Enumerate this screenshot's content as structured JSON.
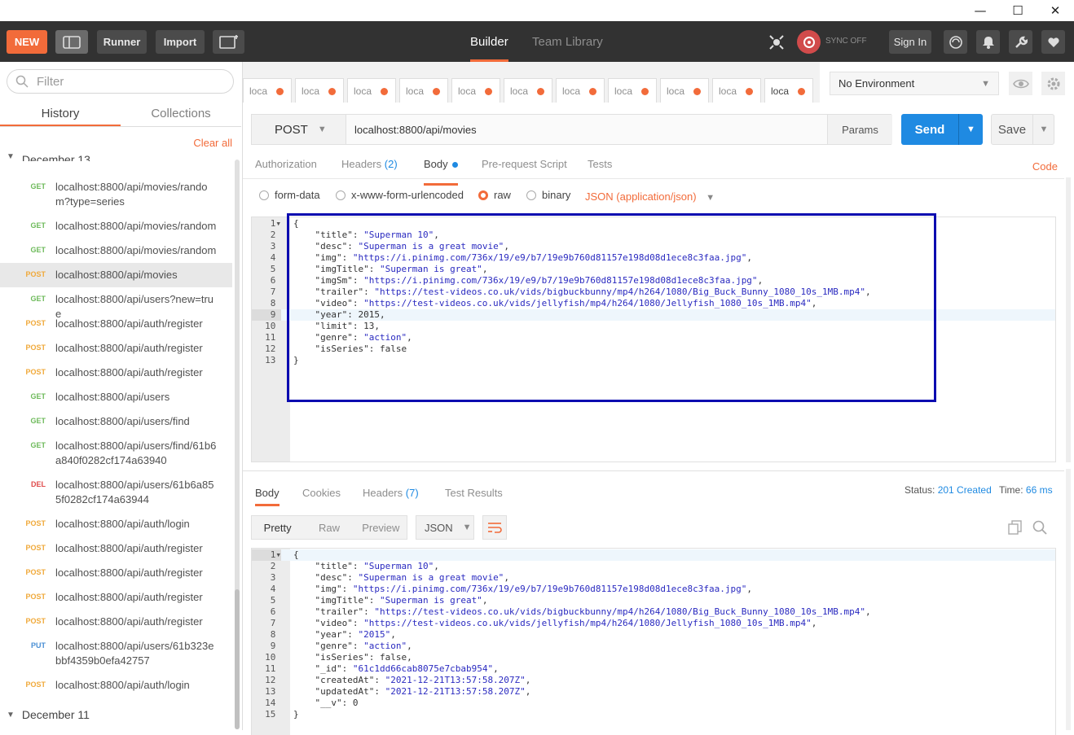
{
  "window": {
    "minimize": "—",
    "maximize": "☐",
    "close": "✕"
  },
  "header": {
    "new_label": "NEW",
    "runner_label": "Runner",
    "import_label": "Import",
    "tabs": [
      {
        "label": "Builder"
      },
      {
        "label": "Team Library"
      }
    ],
    "sync_label": "SYNC OFF",
    "signin_label": "Sign In"
  },
  "sidebar": {
    "filter_placeholder": "Filter",
    "tabs": [
      {
        "label": "History"
      },
      {
        "label": "Collections"
      }
    ],
    "clear_all": "Clear all",
    "section_top": "December 13",
    "items": [
      {
        "method": "GET",
        "url": "localhost:8800/api/movies/random?type=series"
      },
      {
        "method": "GET",
        "url": "localhost:8800/api/movies/random"
      },
      {
        "method": "GET",
        "url": "localhost:8800/api/movies/random"
      },
      {
        "method": "POST",
        "url": "localhost:8800/api/movies"
      },
      {
        "method": "GET",
        "url": "localhost:8800/api/users?new=true"
      },
      {
        "method": "POST",
        "url": "localhost:8800/api/auth/register"
      },
      {
        "method": "POST",
        "url": "localhost:8800/api/auth/register"
      },
      {
        "method": "POST",
        "url": "localhost:8800/api/auth/register"
      },
      {
        "method": "GET",
        "url": "localhost:8800/api/users"
      },
      {
        "method": "GET",
        "url": "localhost:8800/api/users/find"
      },
      {
        "method": "GET",
        "url": "localhost:8800/api/users/find/61b6a840f0282cf174a63940"
      },
      {
        "method": "DEL",
        "url": "localhost:8800/api/users/61b6a855f0282cf174a63944"
      },
      {
        "method": "POST",
        "url": "localhost:8800/api/auth/login"
      },
      {
        "method": "POST",
        "url": "localhost:8800/api/auth/register"
      },
      {
        "method": "POST",
        "url": "localhost:8800/api/auth/register"
      },
      {
        "method": "POST",
        "url": "localhost:8800/api/auth/register"
      },
      {
        "method": "POST",
        "url": "localhost:8800/api/auth/register"
      },
      {
        "method": "PUT",
        "url": "localhost:8800/api/users/61b323ebbf4359b0efa42757"
      },
      {
        "method": "POST",
        "url": "localhost:8800/api/auth/login"
      }
    ],
    "section_bottom": "December 11"
  },
  "request_tabs": [
    "loca",
    "loca",
    "loca",
    "loca",
    "loca",
    "loca",
    "loca",
    "loca",
    "loca",
    "loca",
    "loca"
  ],
  "environment": {
    "selected": "No Environment"
  },
  "request": {
    "method": "POST",
    "url": "localhost:8800/api/movies",
    "params_label": "Params",
    "send_label": "Send",
    "save_label": "Save",
    "tabs": {
      "authorization": "Authorization",
      "headers": "Headers",
      "headers_count": "(2)",
      "body": "Body",
      "prerequest": "Pre-request Script",
      "tests": "Tests"
    },
    "code_link": "Code",
    "body_modes": [
      "form-data",
      "x-www-form-urlencoded",
      "raw",
      "binary"
    ],
    "content_type": "JSON (application/json)",
    "body_lines": [
      "{",
      "    \"title\": \"Superman 10\",",
      "    \"desc\": \"Superman is a great movie\",",
      "    \"img\": \"https://i.pinimg.com/736x/19/e9/b7/19e9b760d81157e198d08d1ece8c3faa.jpg\",",
      "    \"imgTitle\": \"Superman is great\",",
      "    \"imgSm\": \"https://i.pinimg.com/736x/19/e9/b7/19e9b760d81157e198d08d1ece8c3faa.jpg\",",
      "    \"trailer\": \"https://test-videos.co.uk/vids/bigbuckbunny/mp4/h264/1080/Big_Buck_Bunny_1080_10s_1MB.mp4\",",
      "    \"video\": \"https://test-videos.co.uk/vids/jellyfish/mp4/h264/1080/Jellyfish_1080_10s_1MB.mp4\",",
      "    \"year\": 2015,",
      "    \"limit\": 13,",
      "    \"genre\": \"action\",",
      "    \"isSeries\": false",
      "}"
    ]
  },
  "response": {
    "tabs": {
      "body": "Body",
      "cookies": "Cookies",
      "headers": "Headers",
      "headers_count": "(7)",
      "test_results": "Test Results"
    },
    "status_label": "Status:",
    "status_value": "201 Created",
    "time_label": "Time:",
    "time_value": "66 ms",
    "formats": [
      "Pretty",
      "Raw",
      "Preview"
    ],
    "format_type": "JSON",
    "body_lines": [
      "{",
      "    \"title\": \"Superman 10\",",
      "    \"desc\": \"Superman is a great movie\",",
      "    \"img\": \"https://i.pinimg.com/736x/19/e9/b7/19e9b760d81157e198d08d1ece8c3faa.jpg\",",
      "    \"imgTitle\": \"Superman is great\",",
      "    \"trailer\": \"https://test-videos.co.uk/vids/bigbuckbunny/mp4/h264/1080/Big_Buck_Bunny_1080_10s_1MB.mp4\",",
      "    \"video\": \"https://test-videos.co.uk/vids/jellyfish/mp4/h264/1080/Jellyfish_1080_10s_1MB.mp4\",",
      "    \"year\": \"2015\",",
      "    \"genre\": \"action\",",
      "    \"isSeries\": false,",
      "    \"_id\": \"61c1dd66cab8075e7cbab954\",",
      "    \"createdAt\": \"2021-12-21T13:57:58.207Z\",",
      "    \"updatedAt\": \"2021-12-21T13:57:58.207Z\",",
      "    \"__v\": 0",
      "}"
    ]
  },
  "colors": {
    "accent": "#f26b3a",
    "send": "#1f8ae2",
    "header_bg": "#323232",
    "highlight_box": "#0b0bb0"
  }
}
